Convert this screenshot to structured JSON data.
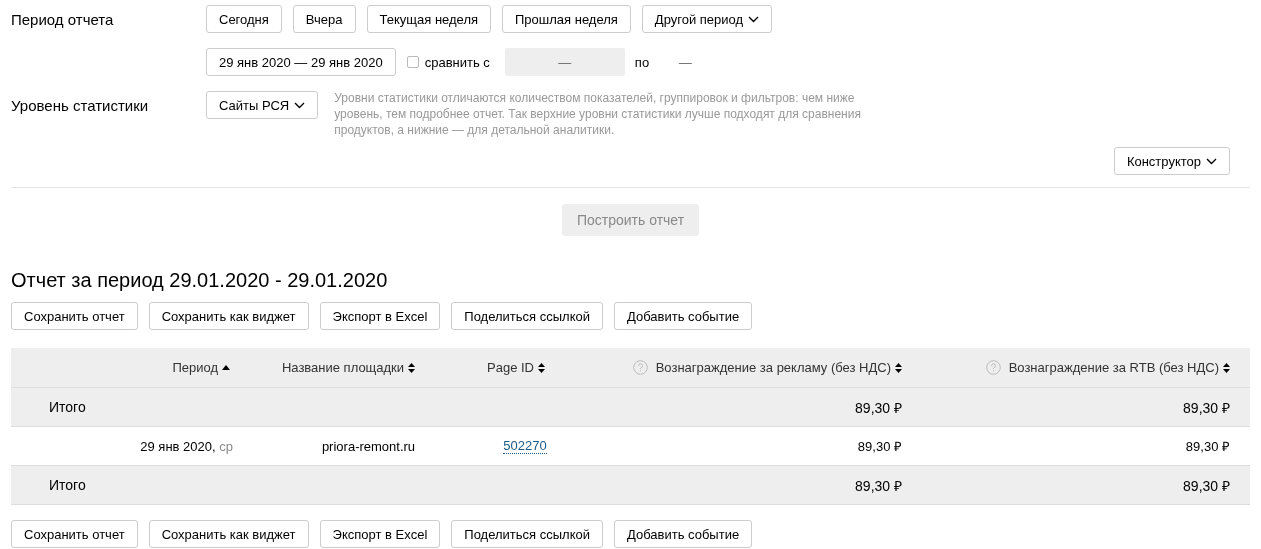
{
  "period": {
    "label": "Период отчета",
    "presets": [
      {
        "label": "Сегодня",
        "kind": "button"
      },
      {
        "label": "Вчера",
        "kind": "button"
      },
      {
        "label": "Текущая неделя",
        "kind": "button"
      },
      {
        "label": "Прошлая неделя",
        "kind": "button"
      },
      {
        "label": "Другой период",
        "kind": "dropdown"
      }
    ],
    "range": "29 янв 2020 — 29 янв 2020",
    "compare": {
      "label": "сравнить с",
      "checked": false,
      "from": "—",
      "to_label": "по",
      "to": "—"
    }
  },
  "level": {
    "label": "Уровень статистики",
    "value": "Сайты РСЯ",
    "hint": "Уровни статистики отличаются количеством показателей, группировок и фильтров: чем ниже уровень, тем подробнее отчет. Так верхние уровни статистики лучше подходят для сравнения продуктов, а нижние — для детальной аналитики."
  },
  "constructor_button": "Конструктор",
  "build_button": {
    "label": "Построить отчет",
    "disabled": true
  },
  "report": {
    "title": "Отчет за период 29.01.2020 - 29.01.2020",
    "actions": [
      "Сохранить отчет",
      "Сохранить как виджет",
      "Экспорт в Excel",
      "Поделиться ссылкой",
      "Добавить событие"
    ],
    "table": {
      "columns": [
        {
          "label": "Период",
          "sorted": true,
          "help": false
        },
        {
          "label": "Название площадки",
          "sorted": false,
          "help": false
        },
        {
          "label": "Page ID",
          "sorted": false,
          "help": false
        },
        {
          "label": "Вознаграждение за рекламу (без НДС)",
          "sorted": false,
          "help": true
        },
        {
          "label": "Вознаграждение за RTB (без НДС)",
          "sorted": false,
          "help": true
        }
      ],
      "rows": [
        {
          "kind": "total",
          "label": "Итого",
          "values": [
            "89,30 ₽",
            "89,30 ₽"
          ]
        },
        {
          "kind": "data",
          "date": "29 янв 2020,",
          "weekday": "ср",
          "site": "priora-remont.ru",
          "page_id": "502270",
          "values": [
            "89,30 ₽",
            "89,30 ₽"
          ]
        },
        {
          "kind": "total",
          "label": "Итого",
          "values": [
            "89,30 ₽",
            "89,30 ₽"
          ]
        }
      ]
    },
    "bottom_actions": [
      "Сохранить отчет",
      "Сохранить как виджет",
      "Экспорт в Excel",
      "Поделиться ссылкой",
      "Добавить событие"
    ]
  }
}
